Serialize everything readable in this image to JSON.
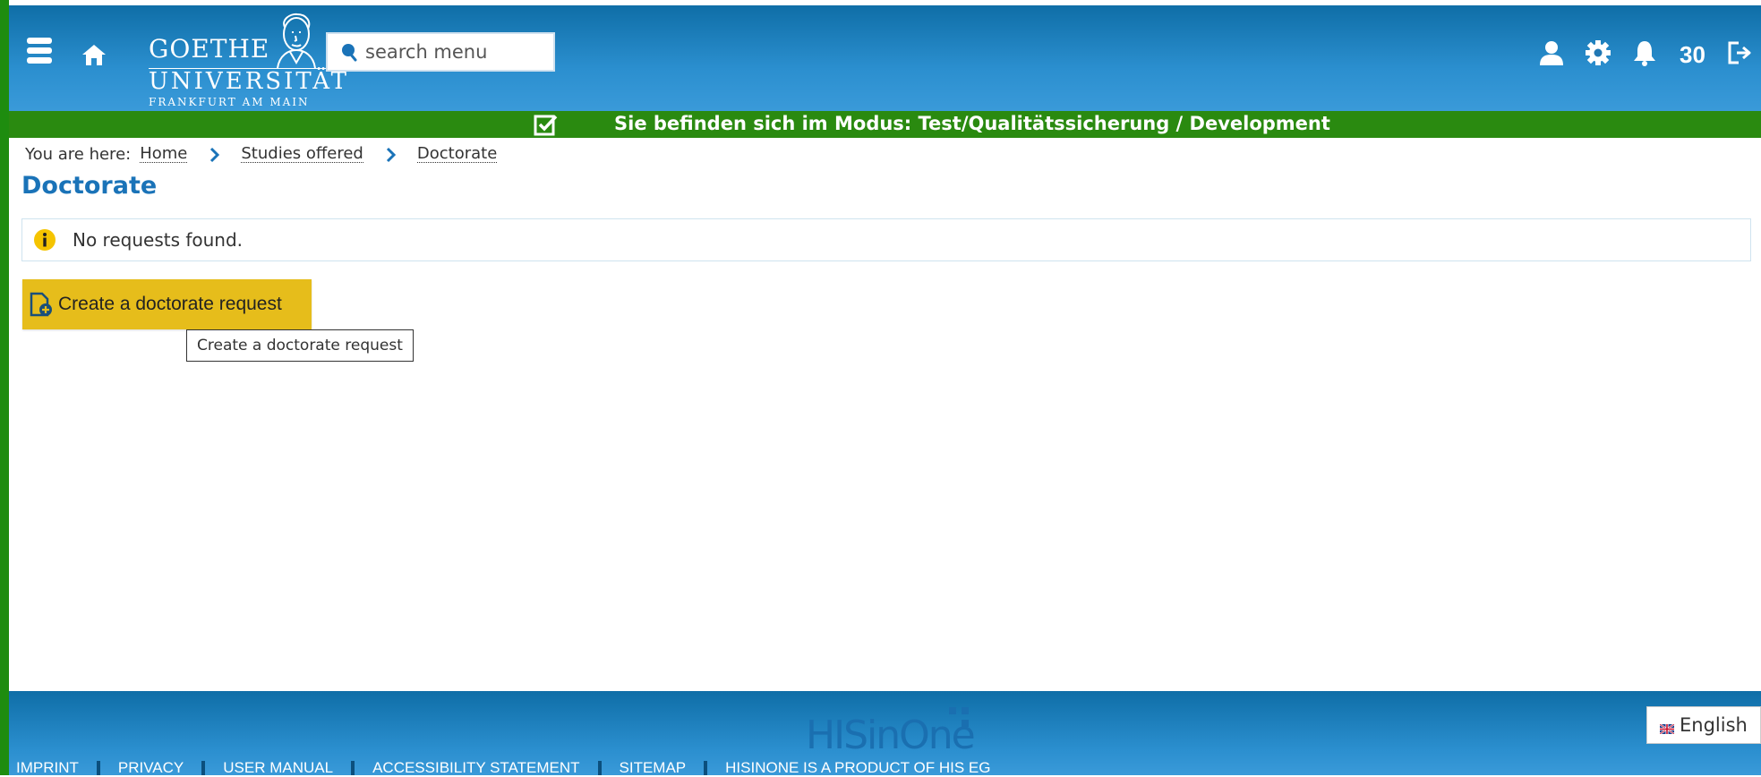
{
  "header": {
    "logo": {
      "line1": "GOETHE",
      "line2": "UNIVERSITÄT",
      "line3": "FRANKFURT AM MAIN"
    },
    "search_placeholder": "search menu",
    "notification_count": "30",
    "icons": {
      "menu": "menu-icon",
      "home": "home-icon",
      "search": "search-icon",
      "user": "user-icon",
      "settings": "gear-icon",
      "notifications": "bell-icon",
      "logout": "logout-icon"
    }
  },
  "mode_bar": {
    "text": "Sie befinden sich im Modus: Test/Qualitätssicherung / Development",
    "icon": "checkbox-icon",
    "color": "#2a8a10"
  },
  "breadcrumb": {
    "prefix": "You are here:",
    "items": [
      "Home",
      "Studies offered",
      "Doctorate"
    ]
  },
  "page": {
    "title": "Doctorate",
    "info_message": "No requests found.",
    "create_button_label": "Create a doctorate request",
    "tooltip": "Create a doctorate request"
  },
  "footer": {
    "brand": "HISinOne",
    "language": "English",
    "links": [
      "IMPRINT",
      "PRIVACY",
      "USER MANUAL",
      "ACCESSIBILITY STATEMENT",
      "SITEMAP",
      "HISINONE IS A PRODUCT OF HIS EG"
    ]
  },
  "colors": {
    "header_blue": "#0f6ea7",
    "accent_yellow": "#e6bd1b",
    "title_blue": "#1a73b8",
    "mode_green": "#2a8a10"
  }
}
